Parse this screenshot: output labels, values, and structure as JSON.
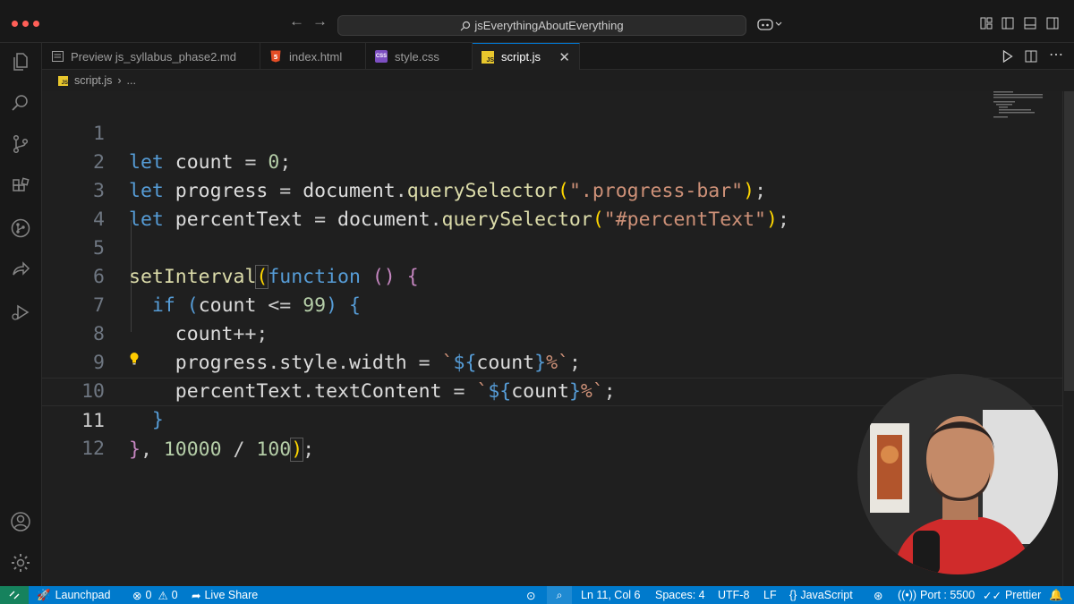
{
  "titlebar": {
    "search_text": "jsEverythingAboutEverything",
    "traffic_color": "#ff5f57"
  },
  "tabs": [
    {
      "label": "Preview js_syllabus_phase2.md",
      "icon": "preview-icon",
      "active": false
    },
    {
      "label": "index.html",
      "icon": "html-file-icon",
      "active": false
    },
    {
      "label": "style.css",
      "icon": "css-file-icon",
      "active": false
    },
    {
      "label": "script.js",
      "icon": "js-file-icon",
      "active": true
    }
  ],
  "breadcrumbs": {
    "file": "script.js",
    "more": "..."
  },
  "editor": {
    "current_line": 11,
    "lines": [
      {
        "number": "1",
        "text": "let count = 0;"
      },
      {
        "number": "2",
        "text": "let progress = document.querySelector(\".progress-bar\");"
      },
      {
        "number": "3",
        "text": "let percentText = document.querySelector(\"#percentText\");"
      },
      {
        "number": "4",
        "text": ""
      },
      {
        "number": "5",
        "text": "setInterval(function () {"
      },
      {
        "number": "6",
        "text": "  if (count <= 99) {"
      },
      {
        "number": "7",
        "text": "    count++;"
      },
      {
        "number": "8",
        "text": "    progress.style.width = `${count}%`;"
      },
      {
        "number": "9",
        "text": "    percentText.textContent = `${count}%`;"
      },
      {
        "number": "10",
        "text": "  }"
      },
      {
        "number": "11",
        "text": "}, 10000 / 100);"
      },
      {
        "number": "12",
        "text": ""
      }
    ]
  },
  "statusbar": {
    "launchpad": "Launchpad",
    "errors": "0",
    "warnings": "0",
    "liveshare": "Live Share",
    "position": "Ln 11, Col 6",
    "spaces": "Spaces: 4",
    "encoding": "UTF-8",
    "eol": "LF",
    "language": "JavaScript",
    "port": "Port : 5500",
    "formatter": "Prettier",
    "bg_color": "#007acc"
  },
  "colors": {
    "keyword": "#569cd6",
    "string": "#ce9178",
    "number": "#b5cea8",
    "function": "#dcdcaa",
    "accent": "#0078d4"
  }
}
